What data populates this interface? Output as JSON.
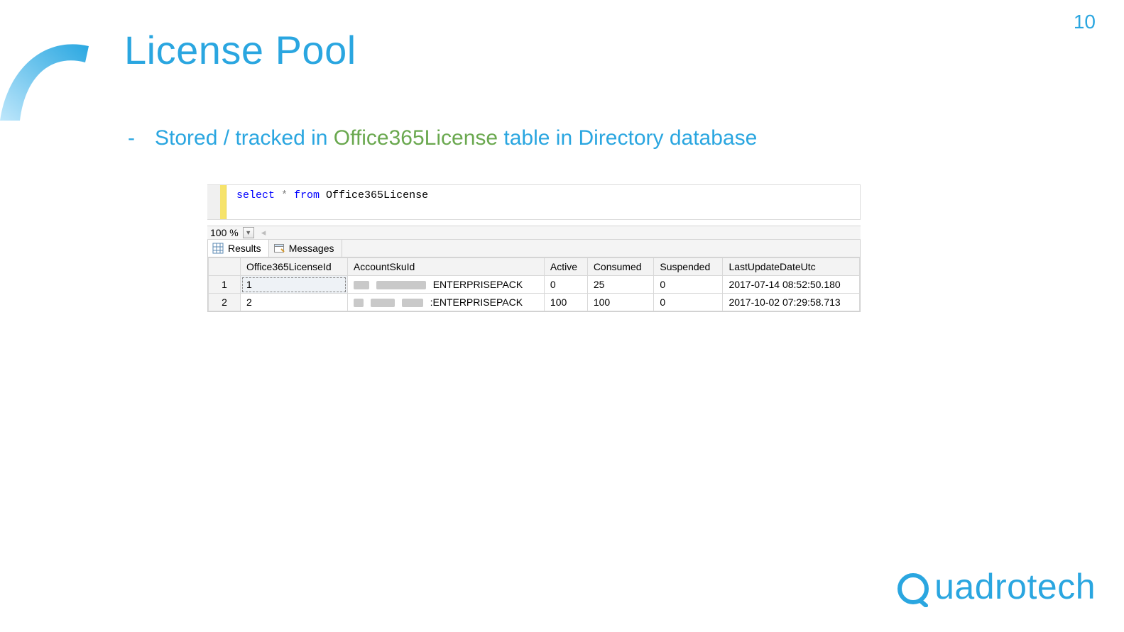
{
  "page_number": "10",
  "title": "License Pool",
  "bullet": {
    "dash": "-",
    "pre": "Stored / tracked in ",
    "em": "Office365License",
    "post": " table in Directory database"
  },
  "query": {
    "select_kw": "select",
    "star": " * ",
    "from_kw": "from",
    "table": " Office365License"
  },
  "zoom": {
    "value": "100 %",
    "caret": "▼",
    "left_arrow": "◂"
  },
  "tabs": {
    "results": "Results",
    "messages": "Messages"
  },
  "columns": [
    "Office365LicenseId",
    "AccountSkuId",
    "Active",
    "Consumed",
    "Suspended",
    "LastUpdateDateUtc"
  ],
  "rows": [
    {
      "rownum": "1",
      "Office365LicenseId": "1",
      "AccountSkuId_suffix": "ENTERPRISEPACK",
      "Active": "0",
      "Consumed": "25",
      "Suspended": "0",
      "LastUpdateDateUtc": "2017-07-14 08:52:50.180"
    },
    {
      "rownum": "2",
      "Office365LicenseId": "2",
      "AccountSkuId_suffix": ":ENTERPRISEPACK",
      "Active": "100",
      "Consumed": "100",
      "Suspended": "0",
      "LastUpdateDateUtc": "2017-10-02 07:29:58.713"
    }
  ],
  "brand": "uadrotech"
}
